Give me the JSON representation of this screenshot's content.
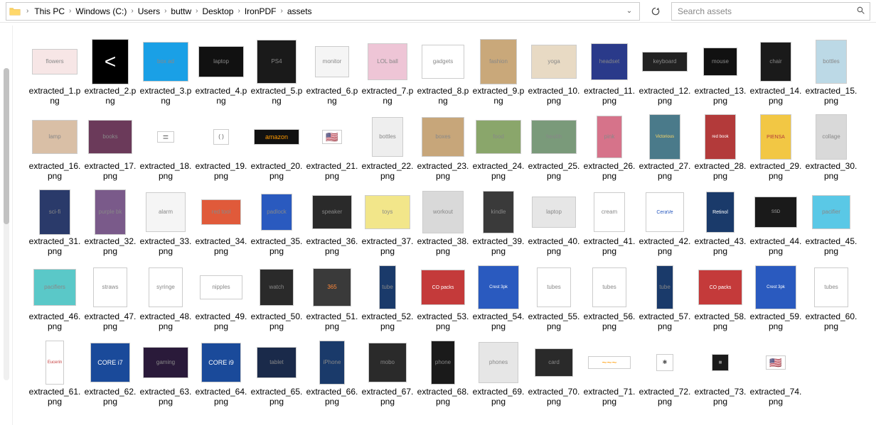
{
  "breadcrumb": {
    "segments": [
      {
        "label": "This PC"
      },
      {
        "label": "Windows (C:)"
      },
      {
        "label": "Users"
      },
      {
        "label": "buttw"
      },
      {
        "label": "Desktop"
      },
      {
        "label": "IronPDF"
      },
      {
        "label": "assets"
      }
    ]
  },
  "search": {
    "placeholder": "Search assets"
  },
  "files": [
    {
      "name": "extracted_1.png",
      "hint": "flowers",
      "bg": "#f7e6e6",
      "w": 64,
      "h": 36
    },
    {
      "name": "extracted_2.png",
      "hint": "<",
      "bg": "#000000",
      "w": 52,
      "h": 64,
      "fg": "#fff",
      "fs": "28px"
    },
    {
      "name": "extracted_3.png",
      "hint": "box ad",
      "bg": "#1aa0e6",
      "w": 64,
      "h": 56
    },
    {
      "name": "extracted_4.png",
      "hint": "laptop",
      "bg": "#111111",
      "w": 64,
      "h": 44
    },
    {
      "name": "extracted_5.png",
      "hint": "PS4",
      "bg": "#1a1a1a",
      "w": 56,
      "h": 62
    },
    {
      "name": "extracted_6.png",
      "hint": "monitor",
      "bg": "#f5f5f5",
      "w": 48,
      "h": 44
    },
    {
      "name": "extracted_7.png",
      "hint": "LOL ball",
      "bg": "#eec5d6",
      "w": 56,
      "h": 52
    },
    {
      "name": "extracted_8.png",
      "hint": "gadgets",
      "bg": "#ffffff",
      "w": 60,
      "h": 48
    },
    {
      "name": "extracted_9.png",
      "hint": "fashion",
      "bg": "#c9a87a",
      "w": 52,
      "h": 64
    },
    {
      "name": "extracted_10.png",
      "hint": "yoga",
      "bg": "#e8dac4",
      "w": 64,
      "h": 48
    },
    {
      "name": "extracted_11.png",
      "hint": "headset",
      "bg": "#2a3a8a",
      "w": 52,
      "h": 52
    },
    {
      "name": "extracted_12.png",
      "hint": "keyboard",
      "bg": "#222222",
      "w": 64,
      "h": 28
    },
    {
      "name": "extracted_13.png",
      "hint": "mouse",
      "bg": "#111111",
      "w": 48,
      "h": 40
    },
    {
      "name": "extracted_14.png",
      "hint": "chair",
      "bg": "#1a1a1a",
      "w": 44,
      "h": 56
    },
    {
      "name": "extracted_15.png",
      "hint": "bottles",
      "bg": "#bcd9e6",
      "w": 44,
      "h": 62
    },
    {
      "name": "extracted_16.png",
      "hint": "lamp",
      "bg": "#d9bfa6",
      "w": 64,
      "h": 48
    },
    {
      "name": "extracted_17.png",
      "hint": "books",
      "bg": "#6b3a5a",
      "w": 62,
      "h": 48
    },
    {
      "name": "extracted_18.png",
      "hint": "=",
      "bg": "#ffffff",
      "w": 24,
      "h": 16,
      "fg": "#555",
      "fs": "14px"
    },
    {
      "name": "extracted_19.png",
      "hint": "( )",
      "bg": "#ffffff",
      "w": 22,
      "h": 22,
      "fg": "#555"
    },
    {
      "name": "extracted_20.png",
      "hint": "amazon",
      "bg": "#111111",
      "w": 64,
      "h": 22,
      "fg": "#ff9900",
      "fs": "9px"
    },
    {
      "name": "extracted_21.png",
      "hint": "🇺🇸",
      "bg": "#ffffff",
      "w": 28,
      "h": 20,
      "fs": "14px"
    },
    {
      "name": "extracted_22.png",
      "hint": "bottles",
      "bg": "#eeeeee",
      "w": 44,
      "h": 56
    },
    {
      "name": "extracted_23.png",
      "hint": "boxes",
      "bg": "#c7a67a",
      "w": 60,
      "h": 56
    },
    {
      "name": "extracted_24.png",
      "hint": "food",
      "bg": "#8aa66b",
      "w": 64,
      "h": 48
    },
    {
      "name": "extracted_25.png",
      "hint": "health",
      "bg": "#7a9a7a",
      "w": 64,
      "h": 48
    },
    {
      "name": "extracted_26.png",
      "hint": "pink",
      "bg": "#d6738a",
      "w": 36,
      "h": 60
    },
    {
      "name": "extracted_27.png",
      "hint": "Victorious",
      "bg": "#4a7a8a",
      "w": 44,
      "h": 64,
      "fg": "#ffd966",
      "fs": "6px"
    },
    {
      "name": "extracted_28.png",
      "hint": "red book",
      "bg": "#b33a3a",
      "w": 44,
      "h": 64,
      "fg": "#fff",
      "fs": "6px"
    },
    {
      "name": "extracted_29.png",
      "hint": "PIENSA",
      "bg": "#f2c744",
      "w": 44,
      "h": 64,
      "fg": "#b33a3a",
      "fs": "7px"
    },
    {
      "name": "extracted_30.png",
      "hint": "collage",
      "bg": "#d9d9d9",
      "w": 44,
      "h": 64
    },
    {
      "name": "extracted_31.png",
      "hint": "sci-fi",
      "bg": "#2a3a6a",
      "w": 44,
      "h": 64
    },
    {
      "name": "extracted_32.png",
      "hint": "purple bk",
      "bg": "#7a5a8a",
      "w": 44,
      "h": 64
    },
    {
      "name": "extracted_33.png",
      "hint": "alarm",
      "bg": "#f5f5f5",
      "w": 56,
      "h": 56
    },
    {
      "name": "extracted_34.png",
      "hint": "red tool",
      "bg": "#e05a3a",
      "w": 56,
      "h": 36
    },
    {
      "name": "extracted_35.png",
      "hint": "padlock",
      "bg": "#2a5abf",
      "w": 44,
      "h": 52
    },
    {
      "name": "extracted_36.png",
      "hint": "speaker",
      "bg": "#2a2a2a",
      "w": 56,
      "h": 48
    },
    {
      "name": "extracted_37.png",
      "hint": "toys",
      "bg": "#f2e68a",
      "w": 64,
      "h": 48
    },
    {
      "name": "extracted_38.png",
      "hint": "workout",
      "bg": "#d9d9d9",
      "w": 58,
      "h": 60
    },
    {
      "name": "extracted_39.png",
      "hint": "kindle",
      "bg": "#3a3a3a",
      "w": 44,
      "h": 60
    },
    {
      "name": "extracted_40.png",
      "hint": "laptop",
      "bg": "#e6e6e6",
      "w": 62,
      "h": 44
    },
    {
      "name": "extracted_41.png",
      "hint": "cream",
      "bg": "#ffffff",
      "w": 44,
      "h": 56
    },
    {
      "name": "extracted_42.png",
      "hint": "CeraVe",
      "bg": "#ffffff",
      "w": 54,
      "h": 56,
      "fg": "#2a5abf",
      "fs": "7px"
    },
    {
      "name": "extracted_43.png",
      "hint": "Retinol",
      "bg": "#1a3a6a",
      "w": 40,
      "h": 58,
      "fg": "#fff",
      "fs": "7px"
    },
    {
      "name": "extracted_44.png",
      "hint": "SSD",
      "bg": "#1a1a1a",
      "w": 60,
      "h": 44,
      "fg": "#aaa",
      "fs": "6px"
    },
    {
      "name": "extracted_45.png",
      "hint": "pacifier",
      "bg": "#5ac8e6",
      "w": 54,
      "h": 48
    },
    {
      "name": "extracted_46.png",
      "hint": "pacifiers",
      "bg": "#5ac8c8",
      "w": 60,
      "h": 52
    },
    {
      "name": "extracted_47.png",
      "hint": "straws",
      "bg": "#ffffff",
      "w": 48,
      "h": 56
    },
    {
      "name": "extracted_48.png",
      "hint": "syringe",
      "bg": "#ffffff",
      "w": 48,
      "h": 56
    },
    {
      "name": "extracted_49.png",
      "hint": "nipples",
      "bg": "#ffffff",
      "w": 60,
      "h": 34
    },
    {
      "name": "extracted_50.png",
      "hint": "watch",
      "bg": "#2a2a2a",
      "w": 48,
      "h": 52
    },
    {
      "name": "extracted_51.png",
      "hint": "365",
      "bg": "#3a3a3a",
      "w": 54,
      "h": 54,
      "fg": "#ff883a",
      "fs": "8px"
    },
    {
      "name": "extracted_52.png",
      "hint": "tube",
      "bg": "#1a3a6a",
      "w": 24,
      "h": 62
    },
    {
      "name": "extracted_53.png",
      "hint": "CO packs",
      "bg": "#c43a3a",
      "w": 62,
      "h": 50,
      "fg": "#fff",
      "fs": "7px"
    },
    {
      "name": "extracted_54.png",
      "hint": "Crest 3pk",
      "bg": "#2a5abf",
      "w": 58,
      "h": 62,
      "fg": "#fff",
      "fs": "6px"
    },
    {
      "name": "extracted_55.png",
      "hint": "tubes",
      "bg": "#ffffff",
      "w": 48,
      "h": 56
    },
    {
      "name": "extracted_56.png",
      "hint": "tubes",
      "bg": "#ffffff",
      "w": 48,
      "h": 56
    },
    {
      "name": "extracted_57.png",
      "hint": "tube",
      "bg": "#1a3a6a",
      "w": 24,
      "h": 62
    },
    {
      "name": "extracted_58.png",
      "hint": "CO packs",
      "bg": "#c43a3a",
      "w": 62,
      "h": 50,
      "fg": "#fff",
      "fs": "7px"
    },
    {
      "name": "extracted_59.png",
      "hint": "Crest 3pk",
      "bg": "#2a5abf",
      "w": 58,
      "h": 62,
      "fg": "#fff",
      "fs": "6px"
    },
    {
      "name": "extracted_60.png",
      "hint": "tubes",
      "bg": "#ffffff",
      "w": 48,
      "h": 56
    },
    {
      "name": "extracted_61.png",
      "hint": "Eucerin",
      "bg": "#ffffff",
      "w": 26,
      "h": 62,
      "fg": "#c43a3a",
      "fs": "6px"
    },
    {
      "name": "extracted_62.png",
      "hint": "CORE i7",
      "bg": "#1a4a9a",
      "w": 56,
      "h": 56,
      "fg": "#fff",
      "fs": "9px"
    },
    {
      "name": "extracted_63.png",
      "hint": "gaming",
      "bg": "#2a1a3a",
      "w": 64,
      "h": 44
    },
    {
      "name": "extracted_64.png",
      "hint": "CORE i9",
      "bg": "#1a4a9a",
      "w": 56,
      "h": 56,
      "fg": "#fff",
      "fs": "9px"
    },
    {
      "name": "extracted_65.png",
      "hint": "tablet",
      "bg": "#1a2a4a",
      "w": 56,
      "h": 44
    },
    {
      "name": "extracted_66.png",
      "hint": "iPhone",
      "bg": "#1a3a6a",
      "w": 36,
      "h": 62
    },
    {
      "name": "extracted_67.png",
      "hint": "mobo",
      "bg": "#2a2a2a",
      "w": 54,
      "h": 56
    },
    {
      "name": "extracted_68.png",
      "hint": "phone",
      "bg": "#1a1a1a",
      "w": 34,
      "h": 62
    },
    {
      "name": "extracted_69.png",
      "hint": "phones",
      "bg": "#e6e6e6",
      "w": 56,
      "h": 58
    },
    {
      "name": "extracted_70.png",
      "hint": "card",
      "bg": "#2a2a2a",
      "w": 54,
      "h": 40
    },
    {
      "name": "extracted_71.png",
      "hint": "~~~",
      "bg": "#ffffff",
      "w": 60,
      "h": 18,
      "fg": "#ff9900",
      "fs": "12px"
    },
    {
      "name": "extracted_72.png",
      "hint": "✱",
      "bg": "#ffffff",
      "w": 24,
      "h": 24,
      "fg": "#555"
    },
    {
      "name": "extracted_73.png",
      "hint": "■",
      "bg": "#1a1a1a",
      "w": 24,
      "h": 24
    },
    {
      "name": "extracted_74.png",
      "hint": "🇺🇸",
      "bg": "#ffffff",
      "w": 28,
      "h": 20,
      "fs": "14px"
    }
  ]
}
